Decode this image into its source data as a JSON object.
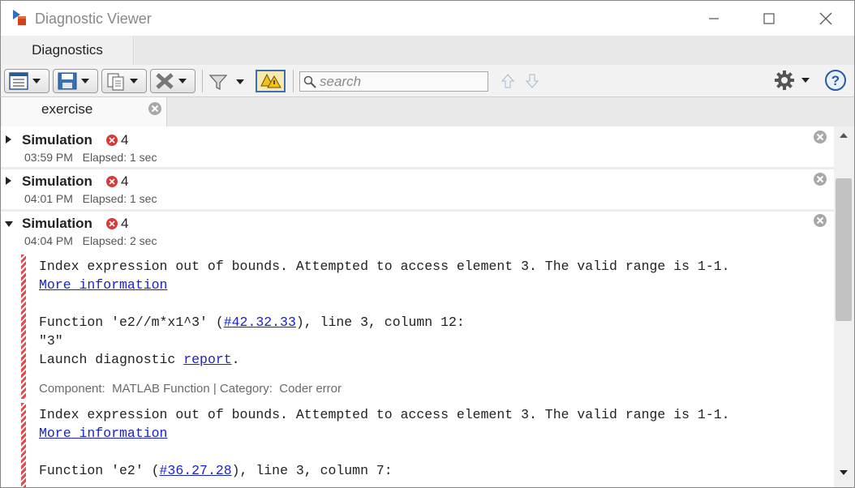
{
  "window": {
    "title": "Diagnostic Viewer",
    "icon": "simulink-model-icon"
  },
  "main_tab": {
    "label": "Diagnostics"
  },
  "toolbar": {
    "buttons": [
      "expand-collapse-icon",
      "save-icon",
      "copy-icon",
      "clear-icon",
      "filter-icon",
      "highlight-warning-icon"
    ],
    "search_placeholder": "search",
    "icons": [
      "settings-gear-icon",
      "help-icon",
      "up-arrow-icon",
      "down-arrow-icon"
    ]
  },
  "document_tab": {
    "label": "exercise"
  },
  "runs": [
    {
      "title": "Simulation",
      "error_count": "4",
      "time": "03:59 PM",
      "elapsed": "Elapsed: 1 sec",
      "state": "collapsed"
    },
    {
      "title": "Simulation",
      "error_count": "4",
      "time": "04:01 PM",
      "elapsed": "Elapsed: 1 sec",
      "state": "collapsed"
    },
    {
      "title": "Simulation",
      "error_count": "4",
      "time": "04:04 PM",
      "elapsed": "Elapsed: 2 sec",
      "state": "expanded"
    }
  ],
  "messages": [
    {
      "line1": "Index expression out of bounds. Attempted to access element 3. The valid range is 1-1.",
      "more_info": "More information",
      "func_prefix": "Function 'e2//m*x1^3' (",
      "func_link": "#42.32.33",
      "func_suffix": "), line 3, column 12:",
      "code": "\"3\"",
      "launch_prefix": "Launch diagnostic ",
      "launch_link": "report",
      "launch_suffix": ".",
      "component_label": "Component:",
      "component_value": "MATLAB Function",
      "category_label": "Category:",
      "category_value": "Coder error"
    },
    {
      "line1": "Index expression out of bounds. Attempted to access element 3. The valid range is 1-1.",
      "more_info": "More information",
      "func_prefix": "Function 'e2' (",
      "func_link": "#36.27.28",
      "func_suffix": "), line 3, column 7:"
    }
  ],
  "colors": {
    "error_red": "#d83a3a",
    "link_blue": "#1a23c9",
    "highlight_toggle_bg": "#f8e9b0"
  }
}
